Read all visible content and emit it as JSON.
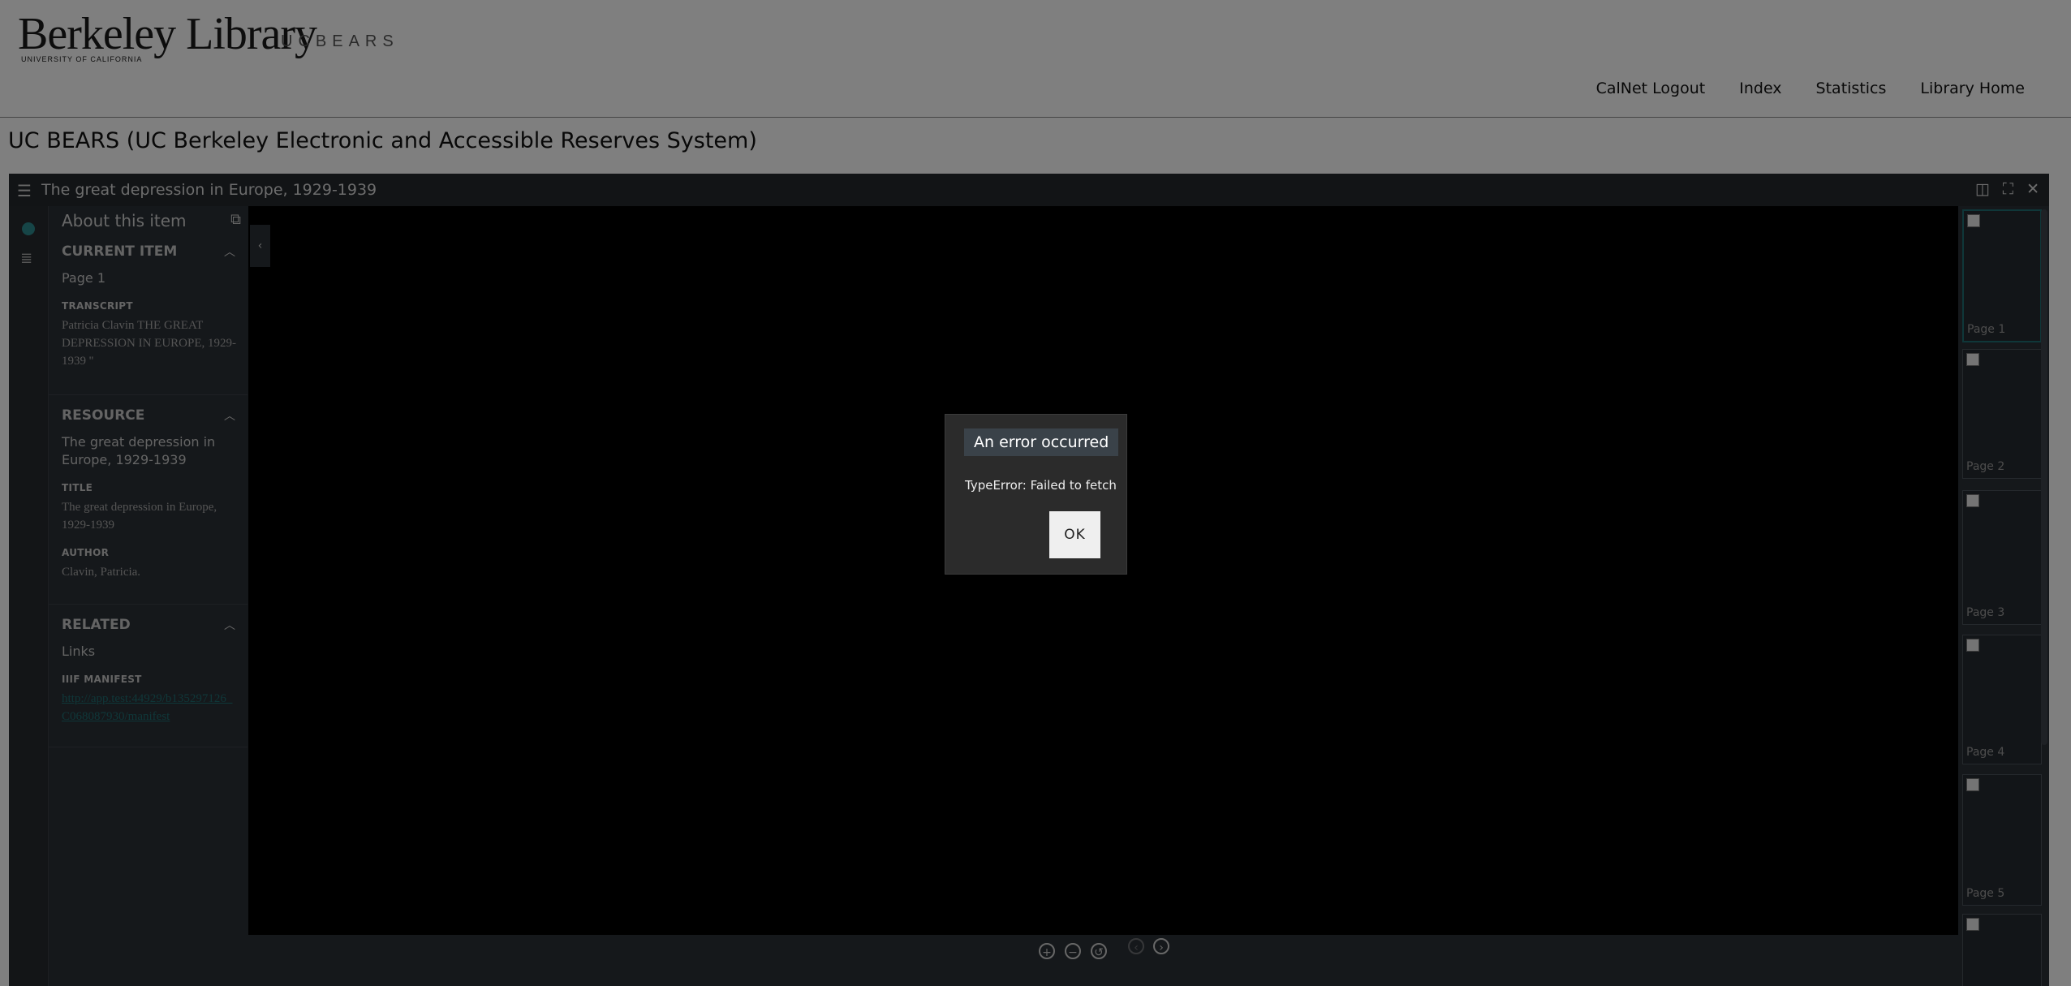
{
  "site": {
    "logo_main": "Berkeley Library",
    "logo_sub": "UNIVERSITY OF CALIFORNIA",
    "app_name": "UCBEARS",
    "nav": [
      "CalNet Logout",
      "Index",
      "Statistics",
      "Library Home"
    ],
    "heading": "UC BEARS (UC Berkeley Electronic and Accessible Reserves System)"
  },
  "viewer": {
    "title": "The great depression in Europe, 1929-1939",
    "panel": {
      "header": "About this item",
      "current_item": {
        "title": "CURRENT ITEM",
        "value": "Page 1",
        "transcript_label": "TRANSCRIPT",
        "transcript": "Patricia Clavin THE GREAT DEPRESSION IN EUROPE, 1929-1939 ''"
      },
      "resource": {
        "title": "RESOURCE",
        "value": "The great depression in Europe, 1929-1939",
        "title_label": "TITLE",
        "title_value": "The great depression in Europe, 1929-1939",
        "author_label": "AUTHOR",
        "author_value": "Clavin, Patricia."
      },
      "related": {
        "title": "RELATED",
        "value": "Links",
        "manifest_label": "IIIF MANIFEST",
        "manifest_url": "http://app.test:44929/b135297126_C068087930/manifest"
      }
    },
    "thumbnails": [
      "Page 1",
      "Page 2",
      "Page 3",
      "Page 4",
      "Page 5"
    ],
    "icons": [
      "menu-icon",
      "book-view-icon",
      "fullscreen-icon",
      "close-icon",
      "zoom-in-icon",
      "zoom-out-icon",
      "reset-icon",
      "previous-icon",
      "next-icon"
    ],
    "accent_color": "#2c8b8e"
  },
  "dialog": {
    "title": "An error occurred",
    "message": "TypeError: Failed to fetch",
    "ok": "OK"
  }
}
